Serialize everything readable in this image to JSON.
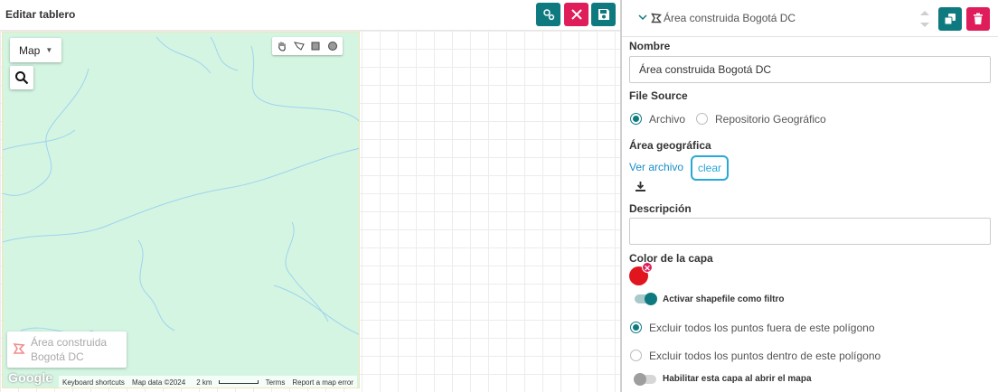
{
  "editor": {
    "title": "Editar tablero",
    "buttons": {
      "settings_icon": "gears-icon",
      "close_icon": "close-icon",
      "save_icon": "save-icon"
    }
  },
  "map": {
    "type_label": "Map",
    "layer_label": "Área construida Bogotá DC",
    "google_logo": "Google",
    "attribution": {
      "shortcuts": "Keyboard shortcuts",
      "data": "Map data ©2024",
      "scale": "2 km",
      "terms": "Terms",
      "report": "Report a map error"
    }
  },
  "panel": {
    "layer_title": "Área construida Bogotá DC",
    "name_label": "Nombre",
    "name_value": "Área construida Bogotá DC",
    "file_source_label": "File Source",
    "file_source_options": [
      "Archivo",
      "Repositorio Geográfico"
    ],
    "file_source_selected": "Archivo",
    "geo_label": "Área geográfica",
    "view_file_link": "Ver archivo",
    "clear_button": "clear",
    "description_label": "Descripción",
    "description_value": "",
    "color_label": "Color de la capa",
    "layer_color": "#e0151e",
    "filter_toggle_label": "Activar shapefile como filtro",
    "filter_toggle_on": true,
    "exclude_options": [
      "Excluir todos los puntos fuera de este polígono",
      "Excluir todos los puntos dentro de este polígono"
    ],
    "exclude_selected": "Excluir todos los puntos fuera de este polígono",
    "enable_on_open_label": "Habilitar esta capa al abrir el mapa",
    "enable_on_open_on": false
  },
  "colors": {
    "accent_teal": "#0e7a80",
    "accent_red": "#de1d5a",
    "link_blue": "#1a8ec9",
    "map_fill": "#d4f5e2"
  }
}
